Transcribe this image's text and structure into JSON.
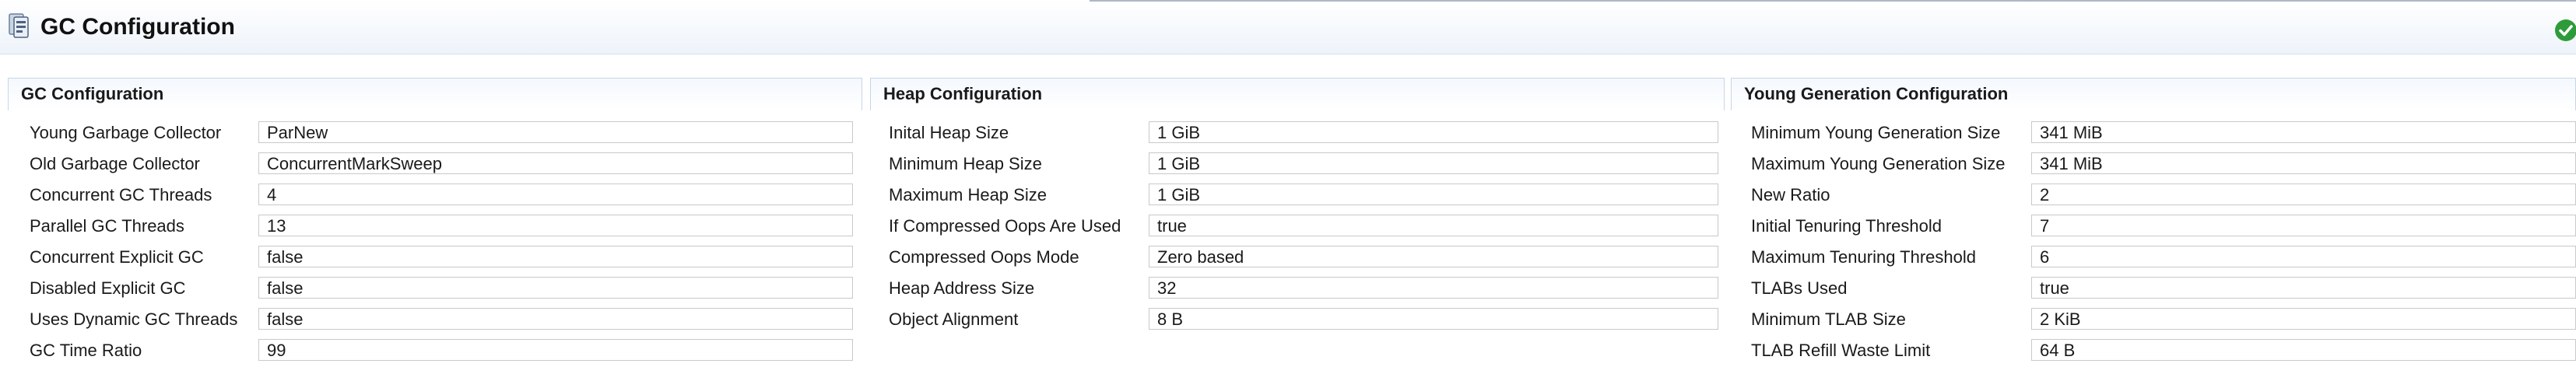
{
  "window": {
    "title": "GC Configuration",
    "icon": "gc-config-icon",
    "status_icon": "ok-check-icon",
    "status_color": "#2e9b3a"
  },
  "sections": [
    {
      "title": "GC Configuration",
      "rows": [
        {
          "label": "Young Garbage Collector",
          "value": "ParNew"
        },
        {
          "label": "Old Garbage Collector",
          "value": "ConcurrentMarkSweep"
        },
        {
          "label": "Concurrent GC Threads",
          "value": "4"
        },
        {
          "label": "Parallel GC Threads",
          "value": "13"
        },
        {
          "label": "Concurrent Explicit GC",
          "value": "false"
        },
        {
          "label": "Disabled Explicit GC",
          "value": "false"
        },
        {
          "label": "Uses Dynamic GC Threads",
          "value": "false"
        },
        {
          "label": "GC Time Ratio",
          "value": "99"
        }
      ]
    },
    {
      "title": "Heap Configuration",
      "rows": [
        {
          "label": "Inital Heap Size",
          "value": "1 GiB"
        },
        {
          "label": "Minimum Heap Size",
          "value": "1 GiB"
        },
        {
          "label": "Maximum Heap Size",
          "value": "1 GiB"
        },
        {
          "label": "If Compressed Oops Are Used",
          "value": "true"
        },
        {
          "label": "Compressed Oops Mode",
          "value": "Zero based"
        },
        {
          "label": "Heap Address Size",
          "value": "32"
        },
        {
          "label": "Object Alignment",
          "value": "8 B"
        }
      ]
    },
    {
      "title": "Young Generation Configuration",
      "rows": [
        {
          "label": "Minimum Young Generation Size",
          "value": "341 MiB"
        },
        {
          "label": "Maximum Young Generation Size",
          "value": "341 MiB"
        },
        {
          "label": "New Ratio",
          "value": "2"
        },
        {
          "label": "Initial Tenuring Threshold",
          "value": "7"
        },
        {
          "label": "Maximum Tenuring Threshold",
          "value": "6"
        },
        {
          "label": "TLABs Used",
          "value": "true"
        },
        {
          "label": "Minimum TLAB Size",
          "value": "2 KiB"
        },
        {
          "label": "TLAB Refill Waste Limit",
          "value": "64 B"
        }
      ]
    }
  ]
}
